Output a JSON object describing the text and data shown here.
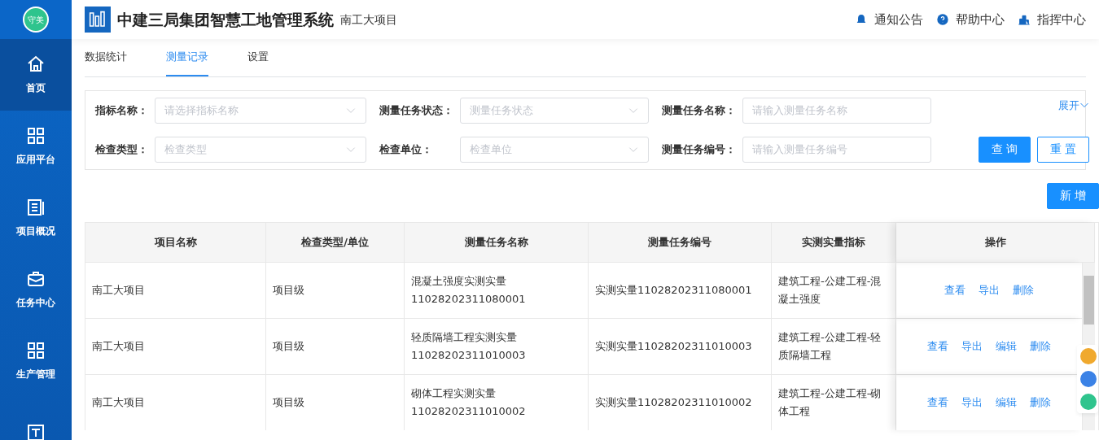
{
  "header": {
    "avatar_text": "守美",
    "title": "中建三局集团智慧工地管理系统",
    "project": "南工大项目",
    "links": [
      {
        "label": "通知公告"
      },
      {
        "label": "帮助中心"
      },
      {
        "label": "指挥中心"
      }
    ]
  },
  "sidebar": {
    "items": [
      {
        "label": "首页",
        "selected": true
      },
      {
        "label": "应用平台",
        "selected": false
      },
      {
        "label": "项目概况",
        "selected": false
      },
      {
        "label": "任务中心",
        "selected": false
      },
      {
        "label": "生产管理",
        "selected": false
      },
      {
        "selected": false
      }
    ]
  },
  "tabs": [
    {
      "label": "数据统计",
      "selected": false
    },
    {
      "label": "测量记录",
      "selected": true
    },
    {
      "label": "设置",
      "selected": false
    }
  ],
  "filters": [
    {
      "kind": "select",
      "label": "指标名称：",
      "placeholder": "请选择指标名称"
    },
    {
      "kind": "select",
      "label": "测量任务状态：",
      "placeholder": "测量任务状态"
    },
    {
      "kind": "input",
      "label": "测量任务名称：",
      "placeholder": "请输入测量任务名称"
    },
    {
      "kind": "select",
      "label": "检查类型：",
      "placeholder": "检查类型"
    },
    {
      "kind": "select",
      "label": "检查单位：",
      "placeholder": "检查单位"
    },
    {
      "kind": "input",
      "label": "测量任务编号：",
      "placeholder": "请输入测量任务编号"
    }
  ],
  "expand_link": "展开",
  "query_button": "查 询",
  "reset_button": "重 置",
  "new_button": "新 增",
  "table": {
    "columns": [
      "项目名称",
      "检查类型/单位",
      "测量任务名称",
      "测量任务编号",
      "实测实量指标",
      "操作"
    ],
    "rows": [
      {
        "cells": [
          "南工大项目",
          "项目级",
          "混凝土强度实测实量 11028202311080001",
          "实测实量11028202311080001",
          "建筑工程-公建工程-混凝土强度"
        ],
        "actions": [
          "查看",
          "导出",
          "删除"
        ]
      },
      {
        "cells": [
          "南工大项目",
          "项目级",
          "轻质隔墙工程实测实量 11028202311010003",
          "实测实量11028202311010003",
          "建筑工程-公建工程-轻质隔墙工程"
        ],
        "actions": [
          "查看",
          "导出",
          "编辑",
          "删除"
        ]
      },
      {
        "cells": [
          "南工大项目",
          "项目级",
          "砌体工程实测实量 11028202311010002",
          "实测实量11028202311010002",
          "建筑工程-公建工程-砌体工程"
        ],
        "actions": [
          "查看",
          "导出",
          "编辑",
          "删除"
        ]
      }
    ]
  },
  "float_tools": [
    {
      "color": "#f0a92e"
    },
    {
      "color": "#3b82e6"
    },
    {
      "color": "#2fc48d"
    }
  ]
}
